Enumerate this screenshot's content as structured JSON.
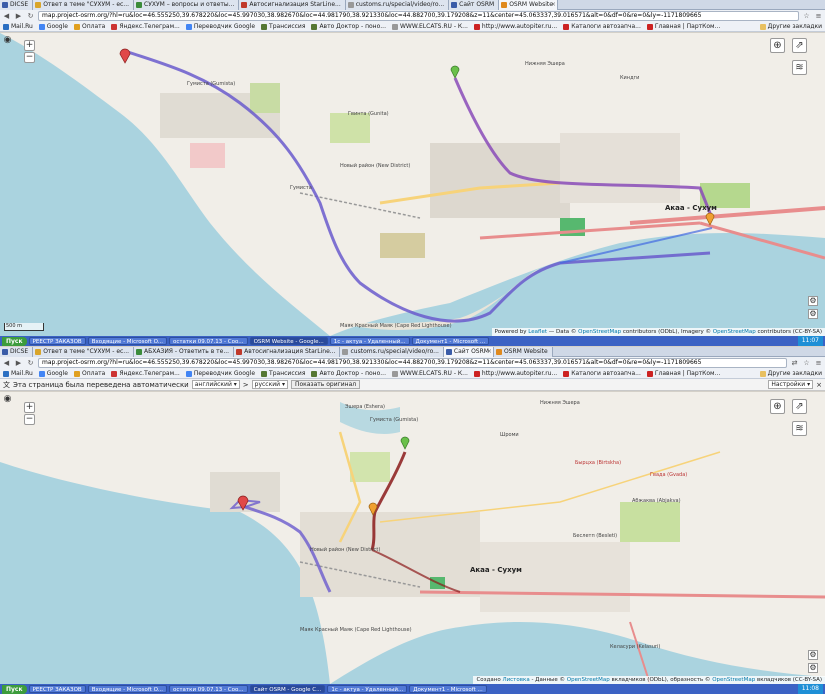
{
  "shot1": {
    "tabs": [
      {
        "label": "DICSE",
        "color": "#3a5ca8"
      },
      {
        "label": "Ответ в теме \"СУХУМ - ес...",
        "color": "#d9a52a"
      },
      {
        "label": "СУХУМ – вопросы и ответы...",
        "color": "#3b8c3b"
      },
      {
        "label": "Автосигнализация StarLine...",
        "color": "#c0392b"
      },
      {
        "label": "customs.ru/special/video/ro...",
        "color": "#999999"
      },
      {
        "label": "Сайт OSRM",
        "color": "#3a5ca8"
      },
      {
        "label": "OSRM Website",
        "color": "#e08a1e"
      }
    ],
    "url": "map.project-osrm.org/?hl=ru&loc=46.555250,39.678220&loc=45.997030,38.982670&loc=44.981790,38.921330&loc=44.882700,39.179208&z=11&center=45.063337,39.016571&alt=0&df=0&re=0&ly=-1171809665",
    "bookmarks": [
      {
        "label": "Mail.Ru",
        "color": "#2b6fc2"
      },
      {
        "label": "Google",
        "color": "#4285f4"
      },
      {
        "label": "Оплата",
        "color": "#e0a020"
      },
      {
        "label": "Яндекс.Телеграм...",
        "color": "#cc3333"
      },
      {
        "label": "Переводчик Google",
        "color": "#4285f4"
      },
      {
        "label": "Трансиссия",
        "color": "#557733"
      },
      {
        "label": "Авто Доктор - поно...",
        "color": "#557733"
      },
      {
        "label": "WWW.ELCATS.RU - К...",
        "color": "#999999"
      },
      {
        "label": "http://www.autopiter.ru...",
        "color": "#cc2222"
      },
      {
        "label": "Каталоги автозапча...",
        "color": "#cc2222"
      },
      {
        "label": "Главная | ПартКом...",
        "color": "#cc2222"
      }
    ],
    "bookmarks_other": "Другие закладки",
    "map_labels": [
      {
        "text": "Акаа - Сухум",
        "big": true
      },
      {
        "text": "Гумиста (Gumista)"
      },
      {
        "text": "Новый район (New District)"
      },
      {
        "text": "Маяк Красный Маяк (Cape Red Lighthouse)"
      },
      {
        "text": "Нижняя Эшера"
      },
      {
        "text": "Гумиста"
      },
      {
        "text": "Гвинта (Gunita)"
      },
      {
        "text": "Киндги"
      }
    ],
    "scale": "500 m",
    "attribution": {
      "pre": "Powered by",
      "leaflet": "Leaflet",
      "mid": "— Data ©",
      "osm": "OpenStreetMap",
      "mid2": "contributors (ODbL), Imagery ©",
      "osm2": "OpenStreetMap",
      "post": "contributors (CC-BY-SA)"
    },
    "taskbar": {
      "start": "Пуск",
      "tasks": [
        "РЕЕСТР ЗАКАЗОВ",
        "Входящие - Microsoft O...",
        "остатки 09.07.13 - Соо...",
        "OSRM Website - Google...",
        "1с - актуа - Удаленный...",
        "Документ1 - Microsoft ..."
      ],
      "active_index": 3,
      "clock": "11:07"
    }
  },
  "shot2": {
    "tabs": [
      {
        "label": "DICSE",
        "color": "#3a5ca8"
      },
      {
        "label": "Ответ в теме \"СУХУМ - ес...",
        "color": "#d9a52a"
      },
      {
        "label": "АБХАЗИЯ - Ответить в те...",
        "color": "#3b8c3b"
      },
      {
        "label": "Автосигнализация StarLine...",
        "color": "#c0392b"
      },
      {
        "label": "customs.ru/special/video/ro...",
        "color": "#999999"
      },
      {
        "label": "Сайт OSRM",
        "color": "#3a5ca8"
      },
      {
        "label": "OSRM Website",
        "color": "#e08a1e"
      }
    ],
    "url": "map.project-osrm.org/?hl=ru&loc=46.555250,39.678220&loc=45.997030,38.982670&loc=44.981790,38.921330&loc=44.882700,39.179208&z=11&center=45.063337,39.016571&alt=0&df=0&re=0&ly=-1171809665",
    "bookmarks": [
      {
        "label": "Mail.Ru",
        "color": "#2b6fc2"
      },
      {
        "label": "Google",
        "color": "#4285f4"
      },
      {
        "label": "Оплата",
        "color": "#e0a020"
      },
      {
        "label": "Яндекс.Телеграм...",
        "color": "#cc3333"
      },
      {
        "label": "Переводчик Google",
        "color": "#4285f4"
      },
      {
        "label": "Трансиссия",
        "color": "#557733"
      },
      {
        "label": "Авто Доктор - поно...",
        "color": "#557733"
      },
      {
        "label": "WWW.ELCATS.RU - К...",
        "color": "#999999"
      },
      {
        "label": "http://www.autopiter.ru...",
        "color": "#cc2222"
      },
      {
        "label": "Каталоги автозапча...",
        "color": "#cc2222"
      },
      {
        "label": "Главная | ПартКом...",
        "color": "#cc2222"
      }
    ],
    "bookmarks_other": "Другие закладки",
    "translate": {
      "message": "Эта страница была переведена автоматически",
      "from": "английский",
      "to": "русский",
      "show_original": "Показать оригинал",
      "settings": "Настройки"
    },
    "map_labels": [
      {
        "text": "Акаа - Сухум",
        "big": true
      },
      {
        "text": "Эшера (Eshera)"
      },
      {
        "text": "Бырцха (Birtskha)",
        "red": true
      },
      {
        "text": "Гвада (Gvada)",
        "red": true
      },
      {
        "text": "Нижняя Эшера"
      },
      {
        "text": "Гумиста (Gumista)"
      },
      {
        "text": "Новый район (New District)"
      },
      {
        "text": "Маяк Красный Маяк (Cape Red Lighthouse)"
      },
      {
        "text": "Беслетп (Besleti)"
      },
      {
        "text": "Келасури (Kelasuri)"
      },
      {
        "text": "Шроми"
      },
      {
        "text": "Абжаква (Abjakva)"
      }
    ],
    "scale": "500 m",
    "attribution": {
      "pre": "Создано",
      "leaflet": "Листовка",
      "mid": "- Данные ©",
      "osm": "OpenStreetMap",
      "mid2": "вкладчиков (ODbL), образность ©",
      "osm2": "OpenStreetMap",
      "post": "вкладчиков (CC-BY-SA)"
    },
    "taskbar": {
      "start": "Пуск",
      "tasks": [
        "РЕЕСТР ЗАКАЗОВ",
        "Входящие - Microsoft O...",
        "остатки 09.07.13 - Соо...",
        "Сайт OSRM - Google C...",
        "1с - актуа - Удаленный...",
        "Документ1 - Microsoft ..."
      ],
      "active_index": 3,
      "clock": "11:08"
    }
  }
}
